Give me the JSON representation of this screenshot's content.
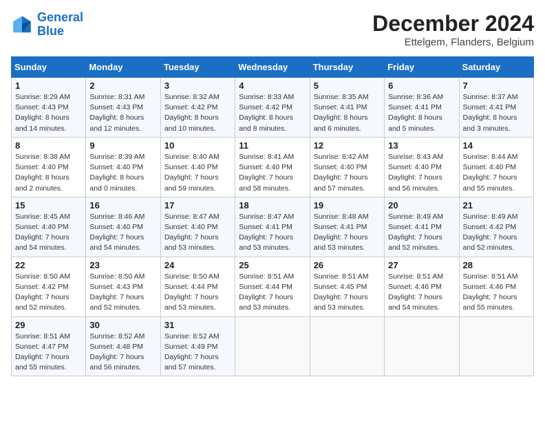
{
  "logo": {
    "line1": "General",
    "line2": "Blue"
  },
  "title": "December 2024",
  "subtitle": "Ettelgem, Flanders, Belgium",
  "days_of_week": [
    "Sunday",
    "Monday",
    "Tuesday",
    "Wednesday",
    "Thursday",
    "Friday",
    "Saturday"
  ],
  "weeks": [
    [
      {
        "day": 1,
        "info": "Sunrise: 8:29 AM\nSunset: 4:43 PM\nDaylight: 8 hours\nand 14 minutes."
      },
      {
        "day": 2,
        "info": "Sunrise: 8:31 AM\nSunset: 4:43 PM\nDaylight: 8 hours\nand 12 minutes."
      },
      {
        "day": 3,
        "info": "Sunrise: 8:32 AM\nSunset: 4:42 PM\nDaylight: 8 hours\nand 10 minutes."
      },
      {
        "day": 4,
        "info": "Sunrise: 8:33 AM\nSunset: 4:42 PM\nDaylight: 8 hours\nand 8 minutes."
      },
      {
        "day": 5,
        "info": "Sunrise: 8:35 AM\nSunset: 4:41 PM\nDaylight: 8 hours\nand 6 minutes."
      },
      {
        "day": 6,
        "info": "Sunrise: 8:36 AM\nSunset: 4:41 PM\nDaylight: 8 hours\nand 5 minutes."
      },
      {
        "day": 7,
        "info": "Sunrise: 8:37 AM\nSunset: 4:41 PM\nDaylight: 8 hours\nand 3 minutes."
      }
    ],
    [
      {
        "day": 8,
        "info": "Sunrise: 8:38 AM\nSunset: 4:40 PM\nDaylight: 8 hours\nand 2 minutes."
      },
      {
        "day": 9,
        "info": "Sunrise: 8:39 AM\nSunset: 4:40 PM\nDaylight: 8 hours\nand 0 minutes."
      },
      {
        "day": 10,
        "info": "Sunrise: 8:40 AM\nSunset: 4:40 PM\nDaylight: 7 hours\nand 59 minutes."
      },
      {
        "day": 11,
        "info": "Sunrise: 8:41 AM\nSunset: 4:40 PM\nDaylight: 7 hours\nand 58 minutes."
      },
      {
        "day": 12,
        "info": "Sunrise: 8:42 AM\nSunset: 4:40 PM\nDaylight: 7 hours\nand 57 minutes."
      },
      {
        "day": 13,
        "info": "Sunrise: 8:43 AM\nSunset: 4:40 PM\nDaylight: 7 hours\nand 56 minutes."
      },
      {
        "day": 14,
        "info": "Sunrise: 8:44 AM\nSunset: 4:40 PM\nDaylight: 7 hours\nand 55 minutes."
      }
    ],
    [
      {
        "day": 15,
        "info": "Sunrise: 8:45 AM\nSunset: 4:40 PM\nDaylight: 7 hours\nand 54 minutes."
      },
      {
        "day": 16,
        "info": "Sunrise: 8:46 AM\nSunset: 4:40 PM\nDaylight: 7 hours\nand 54 minutes."
      },
      {
        "day": 17,
        "info": "Sunrise: 8:47 AM\nSunset: 4:40 PM\nDaylight: 7 hours\nand 53 minutes."
      },
      {
        "day": 18,
        "info": "Sunrise: 8:47 AM\nSunset: 4:41 PM\nDaylight: 7 hours\nand 53 minutes."
      },
      {
        "day": 19,
        "info": "Sunrise: 8:48 AM\nSunset: 4:41 PM\nDaylight: 7 hours\nand 53 minutes."
      },
      {
        "day": 20,
        "info": "Sunrise: 8:49 AM\nSunset: 4:41 PM\nDaylight: 7 hours\nand 52 minutes."
      },
      {
        "day": 21,
        "info": "Sunrise: 8:49 AM\nSunset: 4:42 PM\nDaylight: 7 hours\nand 52 minutes."
      }
    ],
    [
      {
        "day": 22,
        "info": "Sunrise: 8:50 AM\nSunset: 4:42 PM\nDaylight: 7 hours\nand 52 minutes."
      },
      {
        "day": 23,
        "info": "Sunrise: 8:50 AM\nSunset: 4:43 PM\nDaylight: 7 hours\nand 52 minutes."
      },
      {
        "day": 24,
        "info": "Sunrise: 8:50 AM\nSunset: 4:44 PM\nDaylight: 7 hours\nand 53 minutes."
      },
      {
        "day": 25,
        "info": "Sunrise: 8:51 AM\nSunset: 4:44 PM\nDaylight: 7 hours\nand 53 minutes."
      },
      {
        "day": 26,
        "info": "Sunrise: 8:51 AM\nSunset: 4:45 PM\nDaylight: 7 hours\nand 53 minutes."
      },
      {
        "day": 27,
        "info": "Sunrise: 8:51 AM\nSunset: 4:46 PM\nDaylight: 7 hours\nand 54 minutes."
      },
      {
        "day": 28,
        "info": "Sunrise: 8:51 AM\nSunset: 4:46 PM\nDaylight: 7 hours\nand 55 minutes."
      }
    ],
    [
      {
        "day": 29,
        "info": "Sunrise: 8:51 AM\nSunset: 4:47 PM\nDaylight: 7 hours\nand 55 minutes."
      },
      {
        "day": 30,
        "info": "Sunrise: 8:52 AM\nSunset: 4:48 PM\nDaylight: 7 hours\nand 56 minutes."
      },
      {
        "day": 31,
        "info": "Sunrise: 8:52 AM\nSunset: 4:49 PM\nDaylight: 7 hours\nand 57 minutes."
      },
      null,
      null,
      null,
      null
    ]
  ]
}
